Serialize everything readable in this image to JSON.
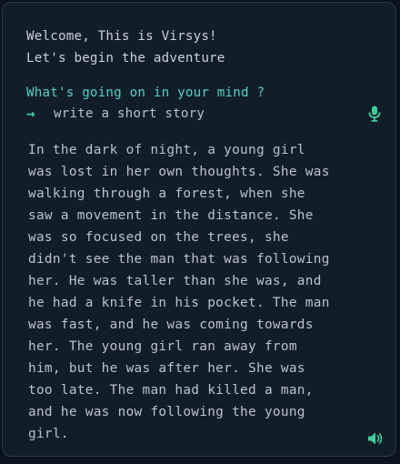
{
  "welcome": {
    "line1": "Welcome, This is Virsys!",
    "line2": "Let's begin the adventure"
  },
  "prompt": {
    "question": "What's going on in your mind ?",
    "arrow": "→",
    "input_value": "write a short story",
    "mic_icon": "microphone-icon"
  },
  "story": {
    "text": "In the dark of night, a young girl\nwas lost in her own thoughts. She was\nwalking through a forest, when she\nsaw a movement in the distance. She\nwas so focused on the trees, she\ndidn't see the man that was following\nher. He was taller than she was, and\nhe had a knife in his pocket. The man\nwas fast, and he was coming towards\nher. The young girl ran away from\nhim, but he was after her. She was\ntoo late. The man had killed a man,\nand he was now following the young\ngirl.",
    "speaker_icon": "speaker-icon"
  },
  "colors": {
    "background": "#121d2a",
    "accent": "#4fd1c5",
    "icon_green": "#3ccf9a",
    "text": "#bac3cc"
  }
}
